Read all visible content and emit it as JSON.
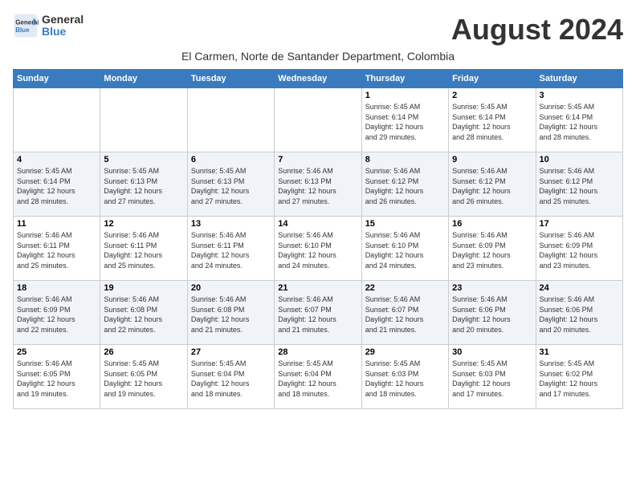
{
  "logo": {
    "line1": "General",
    "line2": "Blue"
  },
  "title": "August 2024",
  "subtitle": "El Carmen, Norte de Santander Department, Colombia",
  "days_of_week": [
    "Sunday",
    "Monday",
    "Tuesday",
    "Wednesday",
    "Thursday",
    "Friday",
    "Saturday"
  ],
  "weeks": [
    [
      {
        "day": "",
        "info": ""
      },
      {
        "day": "",
        "info": ""
      },
      {
        "day": "",
        "info": ""
      },
      {
        "day": "",
        "info": ""
      },
      {
        "day": "1",
        "info": "Sunrise: 5:45 AM\nSunset: 6:14 PM\nDaylight: 12 hours\nand 29 minutes."
      },
      {
        "day": "2",
        "info": "Sunrise: 5:45 AM\nSunset: 6:14 PM\nDaylight: 12 hours\nand 28 minutes."
      },
      {
        "day": "3",
        "info": "Sunrise: 5:45 AM\nSunset: 6:14 PM\nDaylight: 12 hours\nand 28 minutes."
      }
    ],
    [
      {
        "day": "4",
        "info": "Sunrise: 5:45 AM\nSunset: 6:14 PM\nDaylight: 12 hours\nand 28 minutes."
      },
      {
        "day": "5",
        "info": "Sunrise: 5:45 AM\nSunset: 6:13 PM\nDaylight: 12 hours\nand 27 minutes."
      },
      {
        "day": "6",
        "info": "Sunrise: 5:45 AM\nSunset: 6:13 PM\nDaylight: 12 hours\nand 27 minutes."
      },
      {
        "day": "7",
        "info": "Sunrise: 5:46 AM\nSunset: 6:13 PM\nDaylight: 12 hours\nand 27 minutes."
      },
      {
        "day": "8",
        "info": "Sunrise: 5:46 AM\nSunset: 6:12 PM\nDaylight: 12 hours\nand 26 minutes."
      },
      {
        "day": "9",
        "info": "Sunrise: 5:46 AM\nSunset: 6:12 PM\nDaylight: 12 hours\nand 26 minutes."
      },
      {
        "day": "10",
        "info": "Sunrise: 5:46 AM\nSunset: 6:12 PM\nDaylight: 12 hours\nand 25 minutes."
      }
    ],
    [
      {
        "day": "11",
        "info": "Sunrise: 5:46 AM\nSunset: 6:11 PM\nDaylight: 12 hours\nand 25 minutes."
      },
      {
        "day": "12",
        "info": "Sunrise: 5:46 AM\nSunset: 6:11 PM\nDaylight: 12 hours\nand 25 minutes."
      },
      {
        "day": "13",
        "info": "Sunrise: 5:46 AM\nSunset: 6:11 PM\nDaylight: 12 hours\nand 24 minutes."
      },
      {
        "day": "14",
        "info": "Sunrise: 5:46 AM\nSunset: 6:10 PM\nDaylight: 12 hours\nand 24 minutes."
      },
      {
        "day": "15",
        "info": "Sunrise: 5:46 AM\nSunset: 6:10 PM\nDaylight: 12 hours\nand 24 minutes."
      },
      {
        "day": "16",
        "info": "Sunrise: 5:46 AM\nSunset: 6:09 PM\nDaylight: 12 hours\nand 23 minutes."
      },
      {
        "day": "17",
        "info": "Sunrise: 5:46 AM\nSunset: 6:09 PM\nDaylight: 12 hours\nand 23 minutes."
      }
    ],
    [
      {
        "day": "18",
        "info": "Sunrise: 5:46 AM\nSunset: 6:09 PM\nDaylight: 12 hours\nand 22 minutes."
      },
      {
        "day": "19",
        "info": "Sunrise: 5:46 AM\nSunset: 6:08 PM\nDaylight: 12 hours\nand 22 minutes."
      },
      {
        "day": "20",
        "info": "Sunrise: 5:46 AM\nSunset: 6:08 PM\nDaylight: 12 hours\nand 21 minutes."
      },
      {
        "day": "21",
        "info": "Sunrise: 5:46 AM\nSunset: 6:07 PM\nDaylight: 12 hours\nand 21 minutes."
      },
      {
        "day": "22",
        "info": "Sunrise: 5:46 AM\nSunset: 6:07 PM\nDaylight: 12 hours\nand 21 minutes."
      },
      {
        "day": "23",
        "info": "Sunrise: 5:46 AM\nSunset: 6:06 PM\nDaylight: 12 hours\nand 20 minutes."
      },
      {
        "day": "24",
        "info": "Sunrise: 5:46 AM\nSunset: 6:06 PM\nDaylight: 12 hours\nand 20 minutes."
      }
    ],
    [
      {
        "day": "25",
        "info": "Sunrise: 5:46 AM\nSunset: 6:05 PM\nDaylight: 12 hours\nand 19 minutes."
      },
      {
        "day": "26",
        "info": "Sunrise: 5:45 AM\nSunset: 6:05 PM\nDaylight: 12 hours\nand 19 minutes."
      },
      {
        "day": "27",
        "info": "Sunrise: 5:45 AM\nSunset: 6:04 PM\nDaylight: 12 hours\nand 18 minutes."
      },
      {
        "day": "28",
        "info": "Sunrise: 5:45 AM\nSunset: 6:04 PM\nDaylight: 12 hours\nand 18 minutes."
      },
      {
        "day": "29",
        "info": "Sunrise: 5:45 AM\nSunset: 6:03 PM\nDaylight: 12 hours\nand 18 minutes."
      },
      {
        "day": "30",
        "info": "Sunrise: 5:45 AM\nSunset: 6:03 PM\nDaylight: 12 hours\nand 17 minutes."
      },
      {
        "day": "31",
        "info": "Sunrise: 5:45 AM\nSunset: 6:02 PM\nDaylight: 12 hours\nand 17 minutes."
      }
    ]
  ]
}
